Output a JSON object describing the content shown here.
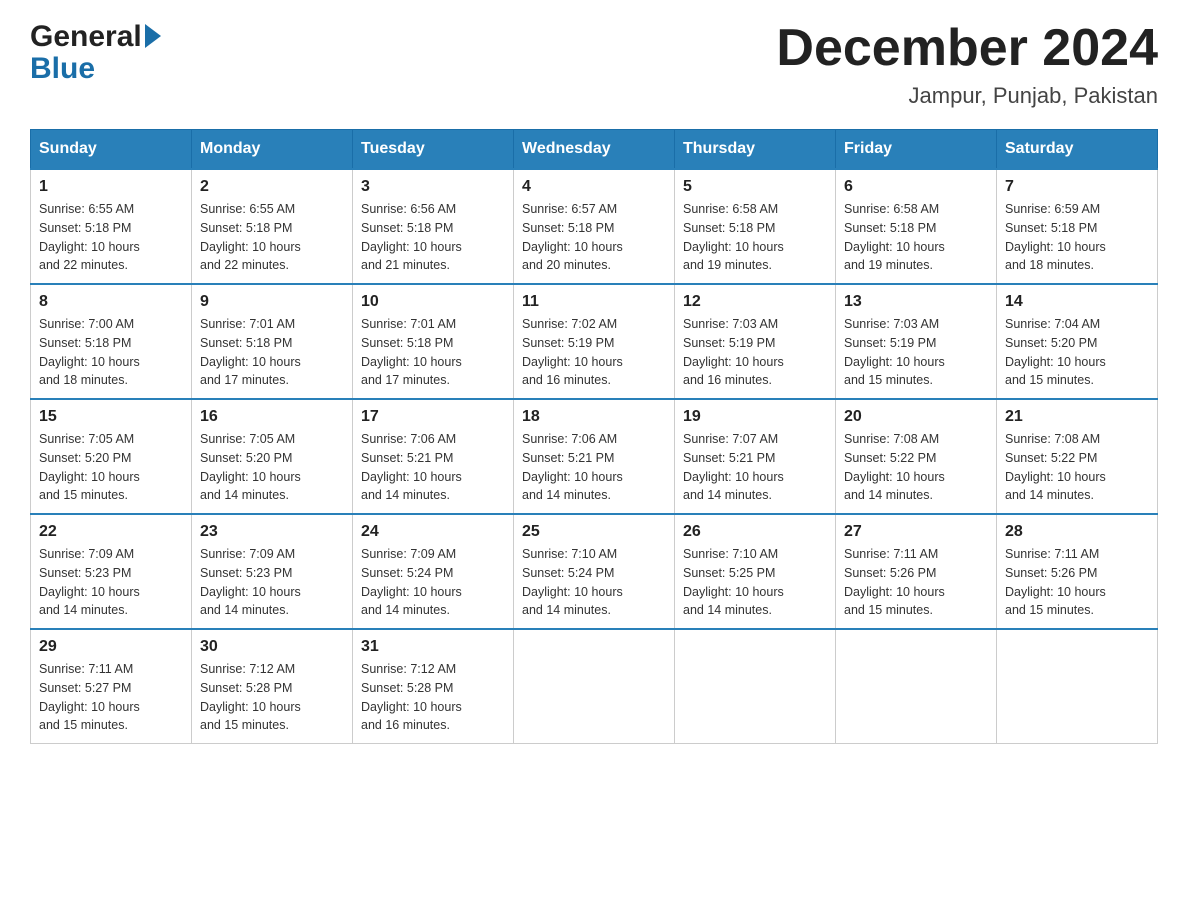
{
  "header": {
    "logo_general": "General",
    "logo_blue": "Blue",
    "month_title": "December 2024",
    "location": "Jampur, Punjab, Pakistan"
  },
  "days_of_week": [
    "Sunday",
    "Monday",
    "Tuesday",
    "Wednesday",
    "Thursday",
    "Friday",
    "Saturday"
  ],
  "weeks": [
    [
      {
        "day": "1",
        "sunrise": "6:55 AM",
        "sunset": "5:18 PM",
        "daylight": "10 hours and 22 minutes."
      },
      {
        "day": "2",
        "sunrise": "6:55 AM",
        "sunset": "5:18 PM",
        "daylight": "10 hours and 22 minutes."
      },
      {
        "day": "3",
        "sunrise": "6:56 AM",
        "sunset": "5:18 PM",
        "daylight": "10 hours and 21 minutes."
      },
      {
        "day": "4",
        "sunrise": "6:57 AM",
        "sunset": "5:18 PM",
        "daylight": "10 hours and 20 minutes."
      },
      {
        "day": "5",
        "sunrise": "6:58 AM",
        "sunset": "5:18 PM",
        "daylight": "10 hours and 19 minutes."
      },
      {
        "day": "6",
        "sunrise": "6:58 AM",
        "sunset": "5:18 PM",
        "daylight": "10 hours and 19 minutes."
      },
      {
        "day": "7",
        "sunrise": "6:59 AM",
        "sunset": "5:18 PM",
        "daylight": "10 hours and 18 minutes."
      }
    ],
    [
      {
        "day": "8",
        "sunrise": "7:00 AM",
        "sunset": "5:18 PM",
        "daylight": "10 hours and 18 minutes."
      },
      {
        "day": "9",
        "sunrise": "7:01 AM",
        "sunset": "5:18 PM",
        "daylight": "10 hours and 17 minutes."
      },
      {
        "day": "10",
        "sunrise": "7:01 AM",
        "sunset": "5:18 PM",
        "daylight": "10 hours and 17 minutes."
      },
      {
        "day": "11",
        "sunrise": "7:02 AM",
        "sunset": "5:19 PM",
        "daylight": "10 hours and 16 minutes."
      },
      {
        "day": "12",
        "sunrise": "7:03 AM",
        "sunset": "5:19 PM",
        "daylight": "10 hours and 16 minutes."
      },
      {
        "day": "13",
        "sunrise": "7:03 AM",
        "sunset": "5:19 PM",
        "daylight": "10 hours and 15 minutes."
      },
      {
        "day": "14",
        "sunrise": "7:04 AM",
        "sunset": "5:20 PM",
        "daylight": "10 hours and 15 minutes."
      }
    ],
    [
      {
        "day": "15",
        "sunrise": "7:05 AM",
        "sunset": "5:20 PM",
        "daylight": "10 hours and 15 minutes."
      },
      {
        "day": "16",
        "sunrise": "7:05 AM",
        "sunset": "5:20 PM",
        "daylight": "10 hours and 14 minutes."
      },
      {
        "day": "17",
        "sunrise": "7:06 AM",
        "sunset": "5:21 PM",
        "daylight": "10 hours and 14 minutes."
      },
      {
        "day": "18",
        "sunrise": "7:06 AM",
        "sunset": "5:21 PM",
        "daylight": "10 hours and 14 minutes."
      },
      {
        "day": "19",
        "sunrise": "7:07 AM",
        "sunset": "5:21 PM",
        "daylight": "10 hours and 14 minutes."
      },
      {
        "day": "20",
        "sunrise": "7:08 AM",
        "sunset": "5:22 PM",
        "daylight": "10 hours and 14 minutes."
      },
      {
        "day": "21",
        "sunrise": "7:08 AM",
        "sunset": "5:22 PM",
        "daylight": "10 hours and 14 minutes."
      }
    ],
    [
      {
        "day": "22",
        "sunrise": "7:09 AM",
        "sunset": "5:23 PM",
        "daylight": "10 hours and 14 minutes."
      },
      {
        "day": "23",
        "sunrise": "7:09 AM",
        "sunset": "5:23 PM",
        "daylight": "10 hours and 14 minutes."
      },
      {
        "day": "24",
        "sunrise": "7:09 AM",
        "sunset": "5:24 PM",
        "daylight": "10 hours and 14 minutes."
      },
      {
        "day": "25",
        "sunrise": "7:10 AM",
        "sunset": "5:24 PM",
        "daylight": "10 hours and 14 minutes."
      },
      {
        "day": "26",
        "sunrise": "7:10 AM",
        "sunset": "5:25 PM",
        "daylight": "10 hours and 14 minutes."
      },
      {
        "day": "27",
        "sunrise": "7:11 AM",
        "sunset": "5:26 PM",
        "daylight": "10 hours and 15 minutes."
      },
      {
        "day": "28",
        "sunrise": "7:11 AM",
        "sunset": "5:26 PM",
        "daylight": "10 hours and 15 minutes."
      }
    ],
    [
      {
        "day": "29",
        "sunrise": "7:11 AM",
        "sunset": "5:27 PM",
        "daylight": "10 hours and 15 minutes."
      },
      {
        "day": "30",
        "sunrise": "7:12 AM",
        "sunset": "5:28 PM",
        "daylight": "10 hours and 15 minutes."
      },
      {
        "day": "31",
        "sunrise": "7:12 AM",
        "sunset": "5:28 PM",
        "daylight": "10 hours and 16 minutes."
      },
      null,
      null,
      null,
      null
    ]
  ],
  "labels": {
    "sunrise": "Sunrise:",
    "sunset": "Sunset:",
    "daylight": "Daylight:"
  }
}
